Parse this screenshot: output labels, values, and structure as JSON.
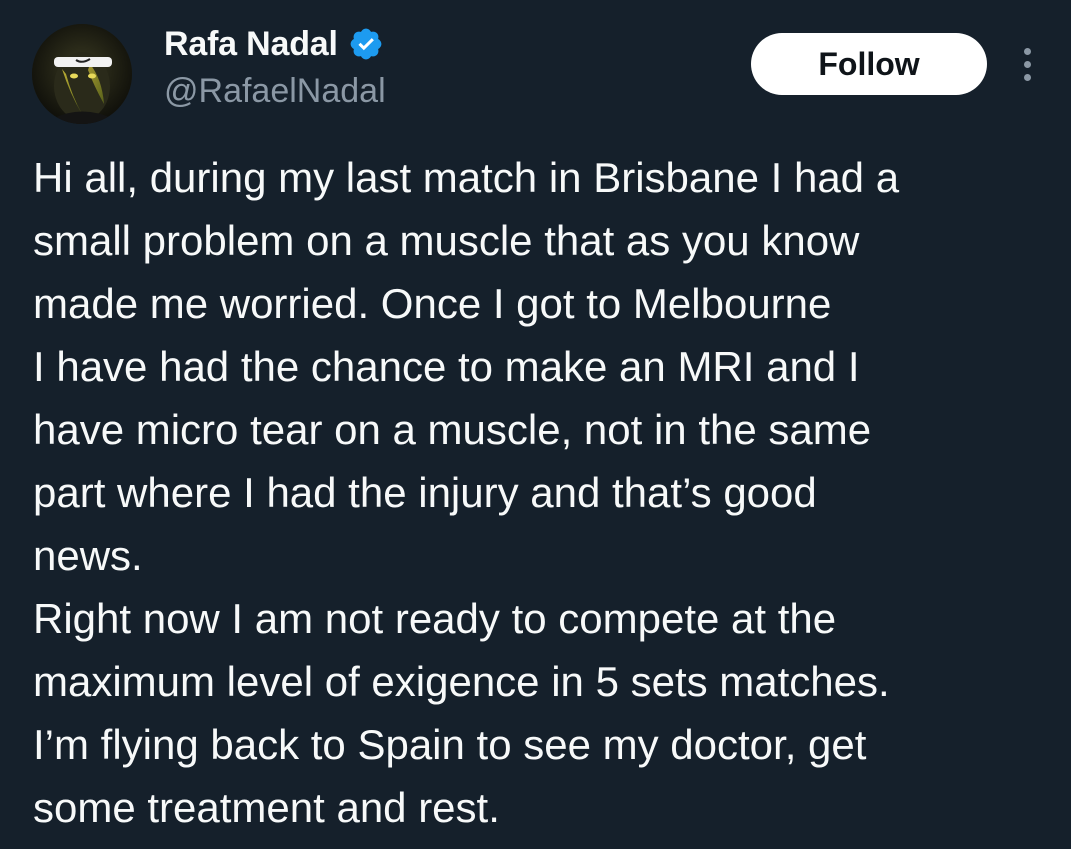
{
  "author": {
    "display_name": "Rafa Nadal",
    "handle": "@RafaelNadal",
    "verified": true,
    "avatar_icon": "profile-photo"
  },
  "actions": {
    "follow_label": "Follow",
    "more_icon": "more-vertical-icon"
  },
  "tweet": {
    "lines": [
      "Hi all, during my last match in Brisbane I had a",
      "small problem on a muscle that as you know",
      "made me worried. Once I got to Melbourne",
      "I have had the chance to make an MRI and I",
      "have micro tear on a muscle, not in the same",
      "part where I had the injury and that’s good",
      "news.",
      "Right now I am not ready to compete at the",
      "maximum level of exigence in 5 sets matches.",
      "I’m flying back to Spain to see my doctor, get",
      "some treatment and rest."
    ]
  },
  "colors": {
    "background": "#15202b",
    "text_primary": "#f7f9f9",
    "text_secondary": "#8b98a5",
    "verified_blue": "#1d9bf0",
    "button_bg": "#ffffff",
    "button_text": "#0f1419"
  }
}
